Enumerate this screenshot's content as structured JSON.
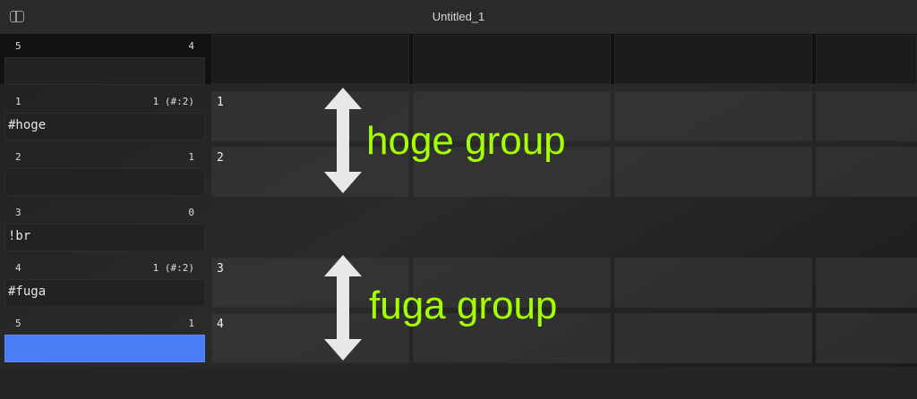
{
  "window": {
    "title": "Untitled_1"
  },
  "lanes": [
    {
      "number": "5",
      "value": "4",
      "text": "",
      "selected": false
    },
    {
      "number": "1",
      "value": "1 (#:2)",
      "text": "#hoge",
      "selected": false
    },
    {
      "number": "2",
      "value": "1",
      "text": "",
      "selected": false
    },
    {
      "number": "3",
      "value": "0",
      "text": "!br",
      "selected": false
    },
    {
      "number": "4",
      "value": "1 (#:2)",
      "text": "#fuga",
      "selected": false
    },
    {
      "number": "5",
      "value": "1",
      "text": "",
      "selected": true
    }
  ],
  "cells": [
    "1",
    "2",
    "3",
    "4"
  ],
  "annotations": {
    "hoge": "hoge group",
    "fuga": "fuga group"
  },
  "colors": {
    "annotation": "#a4ff00",
    "selection": "#4a7cf5"
  }
}
